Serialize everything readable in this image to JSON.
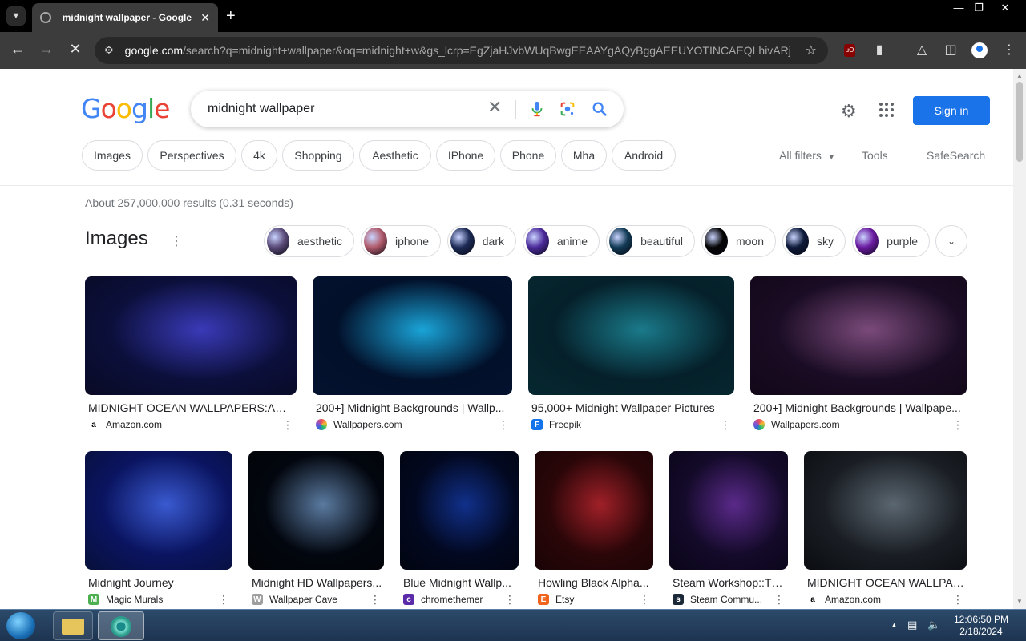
{
  "browser": {
    "tab_title": "midnight wallpaper - Google S",
    "url_host": "google.com",
    "url_path": "/search?q=midnight+wallpaper&oq=midnight+w&gs_lcrp=EgZjaHJvbWUqBwgEEAAYgAQyBggAEEUYOTINCAEQLhivARjH..."
  },
  "search": {
    "query": "midnight wallpaper",
    "signin_label": "Sign in"
  },
  "filters": {
    "chips": [
      "Images",
      "Perspectives",
      "4k",
      "Shopping",
      "Aesthetic",
      "IPhone",
      "Phone",
      "Mha",
      "Android"
    ],
    "all_filters": "All filters",
    "tools": "Tools",
    "safesearch": "SafeSearch"
  },
  "results": {
    "stats": "About 257,000,000 results (0.31 seconds)",
    "images_heading": "Images"
  },
  "refine_chips": [
    {
      "label": "aesthetic",
      "color": "#5a4a78"
    },
    {
      "label": "iphone",
      "color": "#b05a6a"
    },
    {
      "label": "dark",
      "color": "#1c2a55"
    },
    {
      "label": "anime",
      "color": "#4b2a9a"
    },
    {
      "label": "beautiful",
      "color": "#123a55"
    },
    {
      "label": "moon",
      "color": "#050505"
    },
    {
      "label": "sky",
      "color": "#0e1a3a"
    },
    {
      "label": "purple",
      "color": "#6a1aa0"
    }
  ],
  "image_results_row1": [
    {
      "title": "MIDNIGHT OCEAN WALLPAPERS:Amaz...",
      "source": "Amazon.com",
      "icon": "a",
      "icon_color": "#000000",
      "colors": [
        "#0b0f3a",
        "#3a3ab8",
        "#0a0a25"
      ]
    },
    {
      "title": "200+] Midnight Backgrounds | Wallp...",
      "source": "Wallpapers.com",
      "icon": "wallpapers",
      "icon_color": "#e84a5f",
      "colors": [
        "#02102a",
        "#1aa4d8",
        "#041230"
      ]
    },
    {
      "title": "95,000+ Midnight Wallpaper Pictures",
      "source": "Freepik",
      "icon": "F",
      "icon_color": "#1273eb",
      "colors": [
        "#05202a",
        "#1a7a8a",
        "#062830"
      ]
    },
    {
      "title": "200+] Midnight Backgrounds | Wallpape...",
      "source": "Wallpapers.com",
      "icon": "wallpapers",
      "icon_color": "#e84a5f",
      "colors": [
        "#1a0c24",
        "#7a4a7a",
        "#120818"
      ]
    }
  ],
  "image_results_row2": [
    {
      "title": "Midnight Journey",
      "source": "Magic Murals",
      "icon": "M",
      "icon_color": "#4caf50",
      "colors": [
        "#0a1460",
        "#3a5ad0",
        "#08103a"
      ]
    },
    {
      "title": "Midnight HD Wallpapers...",
      "source": "Wallpaper Cave",
      "icon": "W",
      "icon_color": "#9e9e9e",
      "colors": [
        "#02060e",
        "#5a7aa0",
        "#020408"
      ]
    },
    {
      "title": "Blue Midnight Wallp...",
      "source": "chromethemer",
      "icon": "c",
      "icon_color": "#5a2aa8",
      "colors": [
        "#020820",
        "#10308a",
        "#010510"
      ]
    },
    {
      "title": "Howling Black Alpha...",
      "source": "Etsy",
      "icon": "E",
      "icon_color": "#f1641e",
      "colors": [
        "#2a0608",
        "#a02028",
        "#1a0406"
      ]
    },
    {
      "title": "Steam Workshop::Th...",
      "source": "Steam Commu...",
      "icon": "s",
      "icon_color": "#1b2838",
      "colors": [
        "#140a2a",
        "#5a2a8a",
        "#0a0518"
      ]
    },
    {
      "title": "MIDNIGHT OCEAN WALLPAP...",
      "source": "Amazon.com",
      "icon": "a",
      "icon_color": "#000000",
      "colors": [
        "#1a1e24",
        "#5a6670",
        "#0a0c10"
      ]
    }
  ],
  "taskbar": {
    "time": "12:06:50 PM",
    "date": "2/18/2024"
  }
}
